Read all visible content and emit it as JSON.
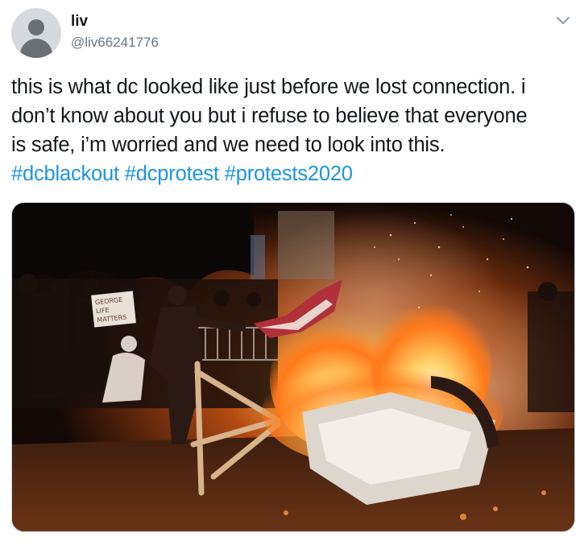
{
  "author": {
    "name": "liv",
    "handle": "@liv66241776"
  },
  "tweet": {
    "line1": "this is what dc looked like just before we lost connection. i",
    "line2": "don’t know about you but i refuse to believe that everyone",
    "line3": "is safe, i’m worried and we need to look into this.",
    "hashtags": [
      "#dcblackout",
      "#dcprotest",
      "#protests2020"
    ]
  },
  "media": {
    "description": "night-protest-fire-photo",
    "sign_text": "GEORGE LIFE MATTERS"
  },
  "icons": {
    "more": "chevron-down-icon",
    "avatar": "default-avatar-icon"
  },
  "colors": {
    "link": "#1b95e0",
    "secondary_text": "#657786",
    "primary_text": "#14171a"
  }
}
